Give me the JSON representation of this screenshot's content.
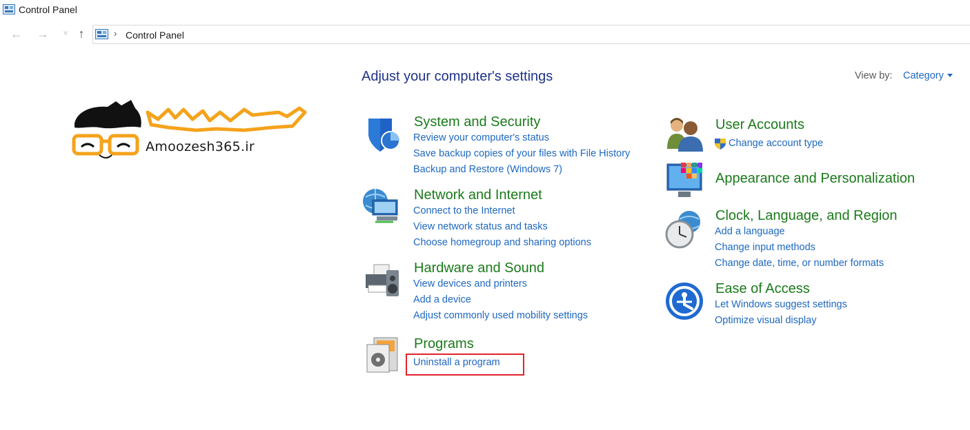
{
  "window": {
    "title": "Control Panel"
  },
  "nav": {
    "back_icon": "back-arrow-icon",
    "forward_icon": "forward-arrow-icon",
    "recent_icon": "chevron-down-icon",
    "up_icon": "up-arrow-icon",
    "separator": "›",
    "breadcrumb": "Control Panel"
  },
  "main": {
    "heading": "Adjust your computer's settings",
    "view_by_label": "View by:",
    "view_by_value": "Category"
  },
  "watermark": {
    "text": "Amoozesh365.ir"
  },
  "categories": [
    {
      "title": "System and Security",
      "icon": "shield-icon",
      "links": [
        "Review your computer's status",
        "Save backup copies of your files with File History",
        "Backup and Restore (Windows 7)"
      ]
    },
    {
      "title": "Network and Internet",
      "icon": "network-globe-icon",
      "links": [
        "Connect to the Internet",
        "View network status and tasks",
        "Choose homegroup and sharing options"
      ]
    },
    {
      "title": "Hardware and Sound",
      "icon": "printer-speaker-icon",
      "links": [
        "View devices and printers",
        "Add a device",
        "Adjust commonly used mobility settings"
      ]
    },
    {
      "title": "Programs",
      "icon": "programs-disc-icon",
      "links": [
        "Uninstall a program"
      ]
    },
    {
      "title": "User Accounts",
      "icon": "users-icon",
      "links": [
        "Change account type"
      ]
    },
    {
      "title": "Appearance and Personalization",
      "icon": "monitor-palette-icon",
      "links": []
    },
    {
      "title": "Clock, Language, and Region",
      "icon": "clock-globe-icon",
      "links": [
        "Add a language",
        "Change input methods",
        "Change date, time, or number formats"
      ]
    },
    {
      "title": "Ease of Access",
      "icon": "ease-of-access-icon",
      "links": [
        "Let Windows suggest settings",
        "Optimize visual display"
      ]
    }
  ],
  "colors": {
    "heading": "#1e3287",
    "category_title": "#1a7a1a",
    "link": "#1e68c0",
    "highlight": "#e0232c"
  }
}
